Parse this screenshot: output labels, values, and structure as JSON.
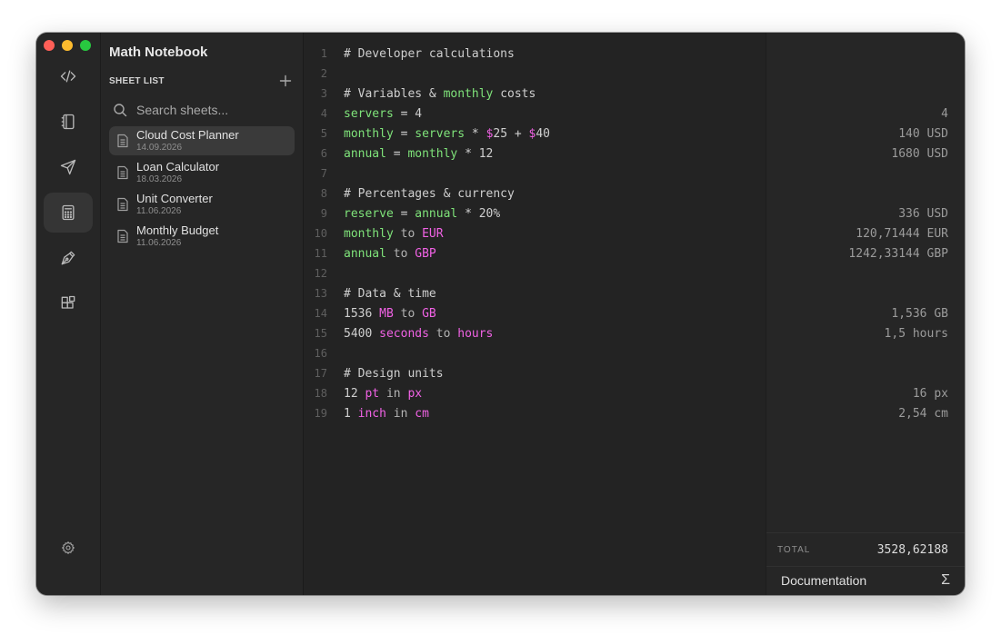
{
  "app": {
    "title": "Math Notebook"
  },
  "sidebar": {
    "section_label": "SHEET LIST",
    "search_placeholder": "Search sheets...",
    "sheets": [
      {
        "name": "Cloud Cost Planner",
        "date": "14.09.2026",
        "active": true
      },
      {
        "name": "Loan Calculator",
        "date": "18.03.2026",
        "active": false
      },
      {
        "name": "Unit Converter",
        "date": "11.06.2026",
        "active": false
      },
      {
        "name": "Monthly Budget",
        "date": "11.06.2026",
        "active": false
      }
    ]
  },
  "activity": {
    "items": [
      {
        "icon": "code-icon"
      },
      {
        "icon": "notebook-icon"
      },
      {
        "icon": "send-icon"
      },
      {
        "icon": "calculator-icon"
      },
      {
        "icon": "pen-tool-icon"
      },
      {
        "icon": "blocks-icon"
      }
    ],
    "active_index": 3
  },
  "editor": {
    "lines": [
      {
        "n": "1",
        "result": "",
        "tokens": [
          [
            "comment",
            "# Developer calculations"
          ]
        ]
      },
      {
        "n": "2",
        "result": "",
        "tokens": []
      },
      {
        "n": "3",
        "result": "",
        "tokens": [
          [
            "comment",
            "# Variables & "
          ],
          [
            "var",
            "monthly"
          ],
          [
            "comment",
            " costs"
          ]
        ]
      },
      {
        "n": "4",
        "result": "4",
        "tokens": [
          [
            "var",
            "servers"
          ],
          [
            "op",
            " = "
          ],
          [
            "num",
            "4"
          ]
        ]
      },
      {
        "n": "5",
        "result": "140 USD",
        "tokens": [
          [
            "var",
            "monthly"
          ],
          [
            "op",
            " = "
          ],
          [
            "var",
            "servers"
          ],
          [
            "op",
            " * "
          ],
          [
            "unit",
            "$"
          ],
          [
            "num",
            "25"
          ],
          [
            "op",
            " + "
          ],
          [
            "unit",
            "$"
          ],
          [
            "num",
            "40"
          ]
        ]
      },
      {
        "n": "6",
        "result": "1680 USD",
        "tokens": [
          [
            "var",
            "annual"
          ],
          [
            "op",
            " = "
          ],
          [
            "var",
            "monthly"
          ],
          [
            "op",
            " * "
          ],
          [
            "num",
            "12"
          ]
        ]
      },
      {
        "n": "7",
        "result": "",
        "tokens": []
      },
      {
        "n": "8",
        "result": "",
        "tokens": [
          [
            "comment",
            "# Percentages & currency"
          ]
        ]
      },
      {
        "n": "9",
        "result": "336 USD",
        "tokens": [
          [
            "var",
            "reserve"
          ],
          [
            "op",
            " = "
          ],
          [
            "var",
            "annual"
          ],
          [
            "op",
            " * "
          ],
          [
            "num",
            "20%"
          ]
        ]
      },
      {
        "n": "10",
        "result": "120,71444 EUR",
        "tokens": [
          [
            "var",
            "monthly"
          ],
          [
            "kw",
            " to "
          ],
          [
            "unit",
            "EUR"
          ]
        ]
      },
      {
        "n": "11",
        "result": "1242,33144 GBP",
        "tokens": [
          [
            "var",
            "annual"
          ],
          [
            "kw",
            " to "
          ],
          [
            "unit",
            "GBP"
          ]
        ]
      },
      {
        "n": "12",
        "result": "",
        "tokens": []
      },
      {
        "n": "13",
        "result": "",
        "tokens": [
          [
            "comment",
            "# Data & time"
          ]
        ]
      },
      {
        "n": "14",
        "result": "1,536 GB",
        "tokens": [
          [
            "num",
            "1536 "
          ],
          [
            "unit",
            "MB"
          ],
          [
            "kw",
            " to "
          ],
          [
            "unit",
            "GB"
          ]
        ]
      },
      {
        "n": "15",
        "result": "1,5 hours",
        "tokens": [
          [
            "num",
            "5400 "
          ],
          [
            "unit",
            "seconds"
          ],
          [
            "kw",
            " to "
          ],
          [
            "unit",
            "hours"
          ]
        ]
      },
      {
        "n": "16",
        "result": "",
        "tokens": []
      },
      {
        "n": "17",
        "result": "",
        "tokens": [
          [
            "comment",
            "# Design units"
          ]
        ]
      },
      {
        "n": "18",
        "result": "16 px",
        "tokens": [
          [
            "num",
            "12 "
          ],
          [
            "unit",
            "pt"
          ],
          [
            "kw",
            " in "
          ],
          [
            "unit",
            "px"
          ]
        ]
      },
      {
        "n": "19",
        "result": "2,54 cm",
        "tokens": [
          [
            "num",
            "1 "
          ],
          [
            "unit",
            "inch"
          ],
          [
            "kw",
            " in "
          ],
          [
            "unit",
            "cm"
          ]
        ]
      }
    ]
  },
  "results": {
    "total_label": "TOTAL",
    "total_value": "3528,62188",
    "documentation_label": "Documentation",
    "sigma_symbol": "Σ"
  },
  "colors": {
    "variable": "#7fe37a",
    "unit": "#f062e4",
    "background": "#232323"
  }
}
